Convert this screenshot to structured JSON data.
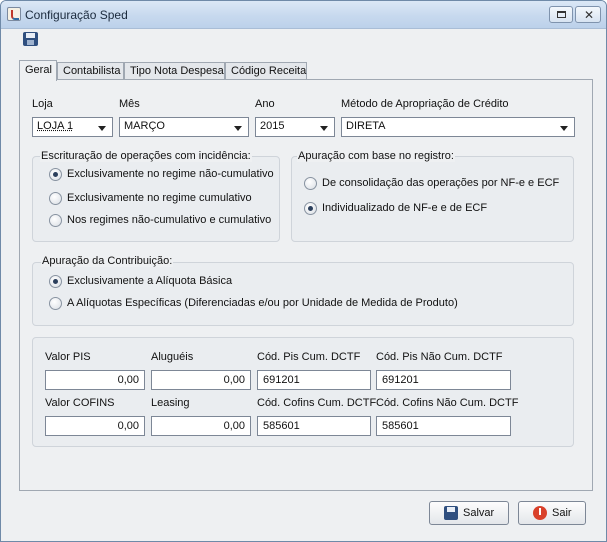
{
  "window": {
    "title": "Configuração Sped"
  },
  "tabs": [
    "Geral",
    "Contabilista",
    "Tipo Nota Despesa",
    "Código Receita"
  ],
  "fields": {
    "loja": {
      "label": "Loja",
      "value": "LOJA 1"
    },
    "mes": {
      "label": "Mês",
      "value": "MARÇO"
    },
    "ano": {
      "label": "Ano",
      "value": "2015"
    },
    "metodo": {
      "label": "Método de Apropriação de Crédito",
      "value": "DIRETA"
    }
  },
  "escrituracao": {
    "title": "Escrituração de operações com incidência:",
    "options": [
      {
        "label": "Exclusivamente no regime não-cumulativo",
        "checked": true
      },
      {
        "label": "Exclusivamente no regime cumulativo",
        "checked": false
      },
      {
        "label": "Nos regimes não-cumulativo e cumulativo",
        "checked": false
      }
    ]
  },
  "apuracao_registro": {
    "title": "Apuração com base no registro:",
    "options": [
      {
        "label": "De consolidação das operações por NF-e e ECF",
        "checked": false
      },
      {
        "label": "Individualizado de NF-e e de ECF",
        "checked": true
      }
    ]
  },
  "apuracao_contribuicao": {
    "title": "Apuração da Contribuição:",
    "options": [
      {
        "label": "Exclusivamente a Alíquota Básica",
        "checked": true
      },
      {
        "label": "A Alíquotas Específicas (Diferenciadas e/ou por Unidade de Medida de Produto)",
        "checked": false
      }
    ]
  },
  "valores": {
    "valor_pis": {
      "label": "Valor PIS",
      "value": "0,00"
    },
    "alugueis": {
      "label": "Aluguéis",
      "value": "0,00"
    },
    "cod_pis_cum": {
      "label": "Cód. Pis Cum. DCTF",
      "value": "691201"
    },
    "cod_pis_nao_cum": {
      "label": "Cód. Pis Não Cum. DCTF",
      "value": "691201"
    },
    "valor_cofins": {
      "label": "Valor COFINS",
      "value": "0,00"
    },
    "leasing": {
      "label": "Leasing",
      "value": "0,00"
    },
    "cod_cofins_cum": {
      "label": "Cód. Cofins Cum. DCTF",
      "value": "585601"
    },
    "cod_cofins_nao_cum": {
      "label": "Cód. Cofins Não Cum. DCTF",
      "value": "585601"
    }
  },
  "buttons": {
    "save": "Salvar",
    "exit": "Sair"
  }
}
